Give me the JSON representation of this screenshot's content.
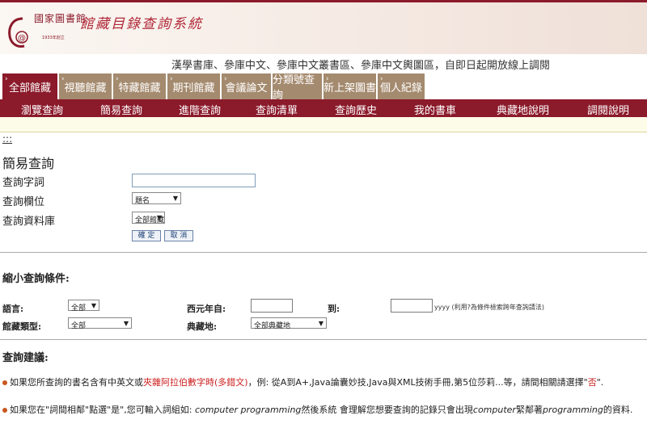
{
  "header": {
    "logo_name": "國家圖書館",
    "logo_year": "1933年創立",
    "system_title": "館藏目錄查詢系統",
    "brand_color": "#8b1a2b"
  },
  "announcement": "漢學書庫、參庫中文、參庫中文叢書區、參庫中文輿圖區，自即日起開放線上調閱",
  "tabs": [
    {
      "label": "全部館藏",
      "active": true
    },
    {
      "label": "視聽館藏",
      "active": false
    },
    {
      "label": "特藏館藏",
      "active": false
    },
    {
      "label": "期刊館藏",
      "active": false
    },
    {
      "label": "會議論文",
      "active": false
    },
    {
      "label": "分類號查詢",
      "active": false
    },
    {
      "label": "新上架圖書",
      "active": false
    },
    {
      "label": "個人紀錄",
      "active": false
    }
  ],
  "subnav": [
    "瀏覽查詢",
    "簡易查詢",
    "進階查詢",
    "查詢清單",
    "查詢歷史",
    "我的書車",
    "典藏地說明",
    "調閱說明"
  ],
  "accesskey": ":::",
  "simple_search": {
    "title": "簡易查詢",
    "query_label": "查詢字詞",
    "query_value": "",
    "field_label": "查詢欄位",
    "field_value": "題名",
    "db_label": "查詢資料庫",
    "db_value": "全部館藏",
    "confirm": "確 定",
    "cancel": "取 消"
  },
  "narrow": {
    "title": "縮小查詢條件:",
    "language_label": "語言:",
    "language_value": "全部",
    "year_from_label": "西元年自:",
    "year_to_label": "到:",
    "year_hint": "yyyy (利用?為條件檢索跨年查詢請法)",
    "material_label": "館藏類型:",
    "material_value": "全部",
    "location_label": "典藏地:",
    "location_value": "全部典藏地"
  },
  "tips": {
    "title": "查詢建議:",
    "tip1_a": "如果您所查詢的書名含有中英文或",
    "tip1_b": "夾雜阿拉伯數字時(多錯文)",
    "tip1_c": "，例: 從A到A+,Java論囊妙技,Java與XML技術手冊,第5位莎莉...等，請間相關請選擇\"",
    "tip1_d": "否",
    "tip1_e": "\".",
    "tip2_a": "如果您在\"詞間相鄰\"點選\"是\",您可輸入詞組如: ",
    "tip2_b": "computer programming",
    "tip2_c": "然後系統 會理解您想要查詢的記錄只會出現",
    "tip2_d": "computer",
    "tip2_e": "緊鄰著",
    "tip2_f": "programming",
    "tip2_g": "的資料."
  }
}
